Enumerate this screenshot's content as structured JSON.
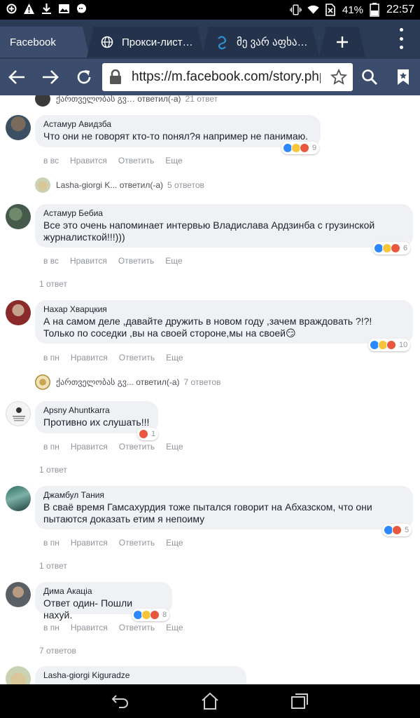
{
  "status_bar": {
    "battery": "41%",
    "time": "22:57",
    "icons": [
      "sync-icon",
      "warning-icon",
      "download-icon",
      "image-icon",
      "chat-icon",
      "vibrate-icon",
      "wifi-icon",
      "no-sim-icon",
      "battery-icon"
    ]
  },
  "tabs": [
    {
      "label": "Facebook",
      "active": true
    },
    {
      "label": "Прокси-лист…",
      "icon": "globe-icon"
    },
    {
      "label": "მე ვარ აფხა…",
      "icon": "site-icon"
    }
  ],
  "toolbar": {
    "url": "https://m.facebook.com/story.php"
  },
  "top_partial_reply": {
    "text": "ქართველობას გვ… ответил(-а)",
    "count": "21 ответ"
  },
  "comments": [
    {
      "author": "Астамур Авидзба",
      "lines": [
        "Что они не говорят кто-то понял?я например не панимаю."
      ],
      "reactions": [
        "like",
        "haha",
        "angry"
      ],
      "reaction_count": "9",
      "time": "в вс",
      "reply_summary": {
        "name": "Lasha-giorgi K...",
        "action": "ответил(-а)",
        "count": "5 ответов"
      }
    },
    {
      "author": "Астамур Бебиа",
      "lines": [
        "Все это очень напоминает интервью Владислава Ардзинба с грузинской",
        "журналисткой!!!)))"
      ],
      "reactions": [
        "like",
        "haha",
        "angry"
      ],
      "reaction_count": "6",
      "time": "в вс",
      "replies_link": "1 ответ"
    },
    {
      "author": "Нахар Хварцкия",
      "lines": [
        "А на самом деле ,давайте дружить в новом году ,зачем враждовать ?!?!",
        "Только по соседки ,вы на своей стороне,мы на своей😏"
      ],
      "reactions": [
        "like",
        "haha",
        "angry"
      ],
      "reaction_count": "10",
      "time": "в пн",
      "reply_summary": {
        "name": "ქართველობას გვ...",
        "action": "ответил(-а)",
        "count": "7 ответов"
      }
    },
    {
      "author": "Apsny Ahuntkarra",
      "lines": [
        "Противно их слушать!!!"
      ],
      "reactions": [
        "angry"
      ],
      "reaction_count": "1",
      "time": "в пн",
      "replies_link": "1 ответ"
    },
    {
      "author": "Джамбул Тания",
      "lines": [
        "В сваё время Гамсахурдия тоже пытался говорит на Абхазском, что они",
        "пытаются доказать етим я непоиму"
      ],
      "reactions": [
        "like",
        "angry"
      ],
      "reaction_count": "5",
      "time": "в пн",
      "replies_link": "1 ответ"
    },
    {
      "author": "Дима Акаціа",
      "lines": [
        "Ответ один- Пошли нахуй."
      ],
      "reactions": [
        "like",
        "haha",
        "angry"
      ],
      "reaction_count": "8",
      "time": "в пн",
      "replies_link": "7 ответов"
    },
    {
      "author": "Lasha-giorgi Kiguradze",
      "lines": []
    }
  ],
  "actions": {
    "like": "Нравится",
    "reply": "Ответить",
    "more": "Еще"
  },
  "colors": {
    "status_bar": "#000000",
    "tab_strip": "#2b3a55",
    "toolbar": "#3b4c6c",
    "bubble": "#f0f1f4",
    "like": "#2d88ff",
    "haha": "#f7c43a",
    "angry": "#e9573e"
  }
}
